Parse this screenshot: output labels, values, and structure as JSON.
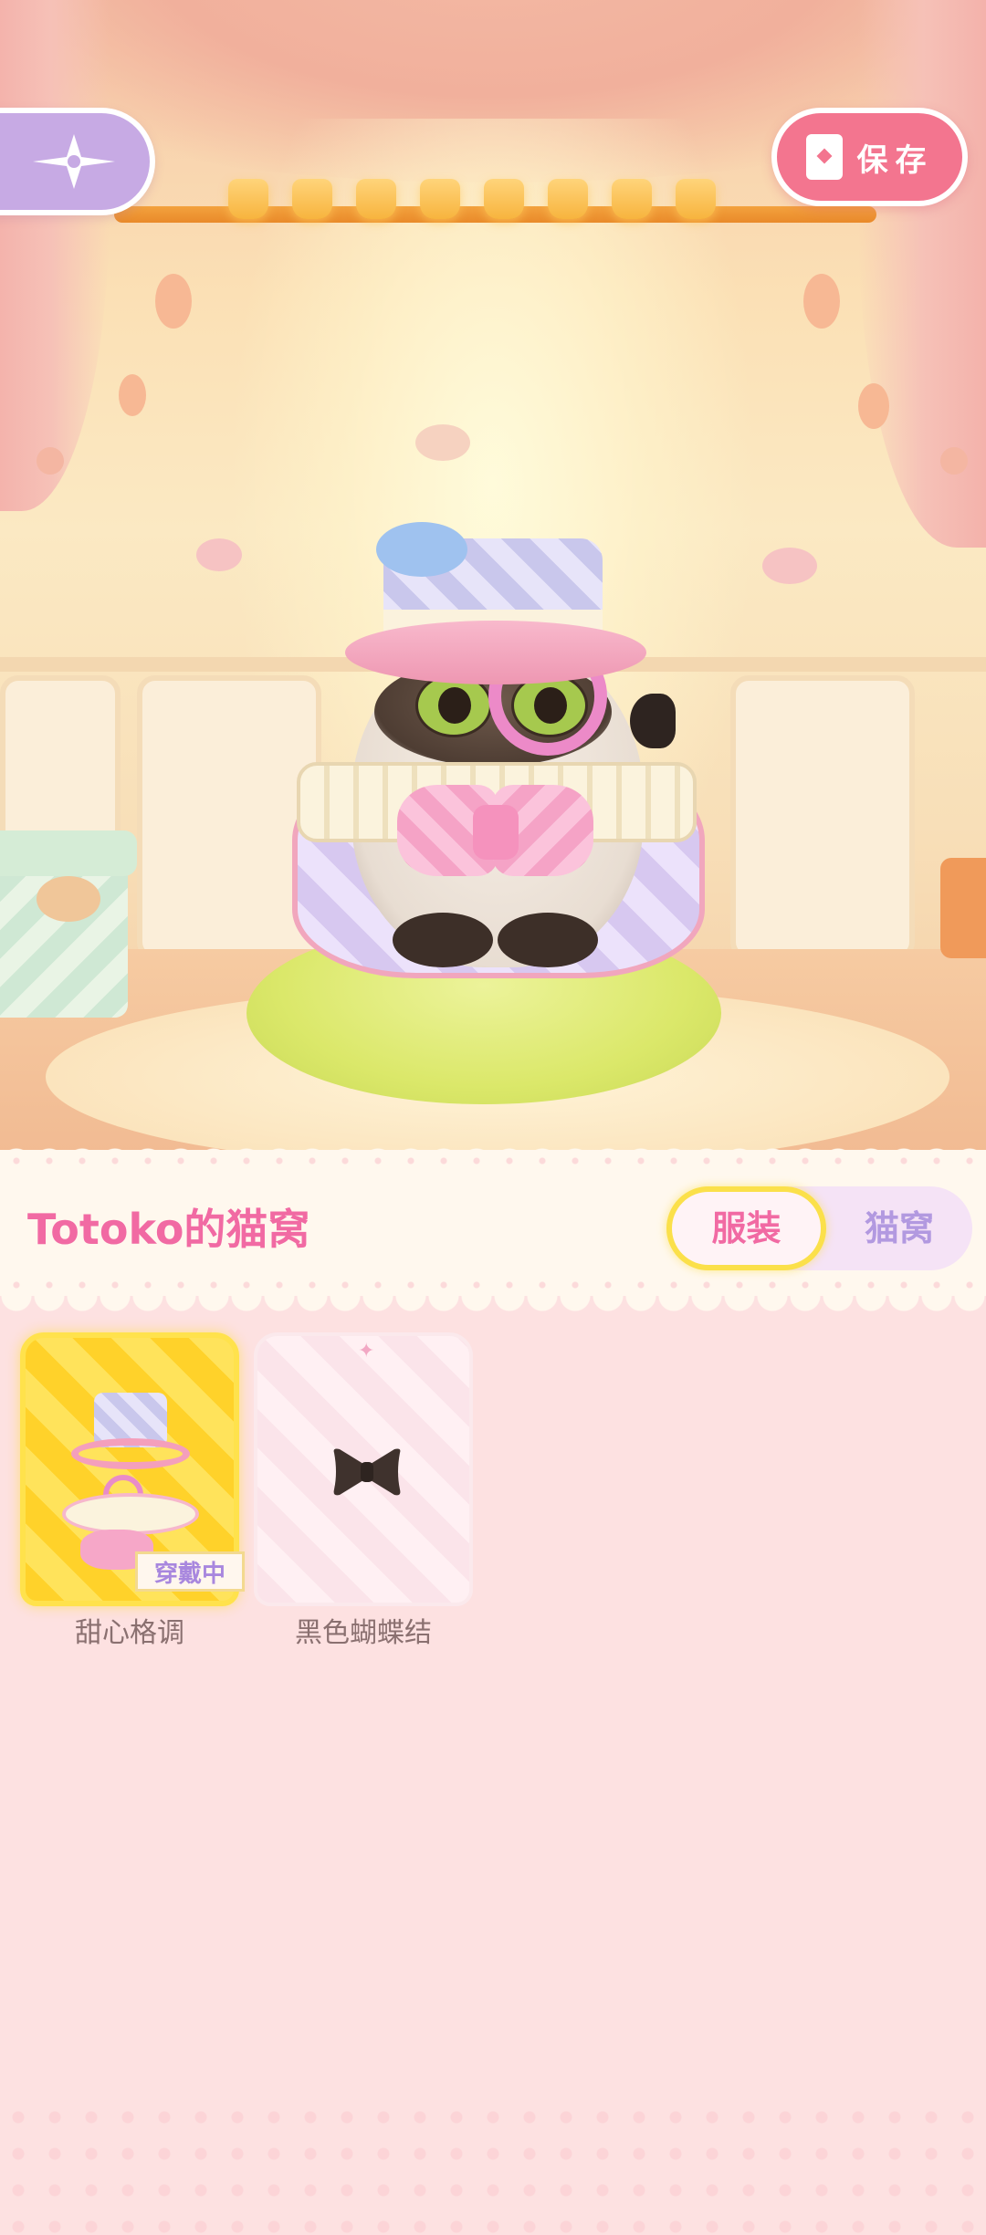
{
  "header": {
    "save_label": "保存",
    "title": "Totoko的猫窝"
  },
  "tabs": [
    {
      "label": "服装",
      "selected": true
    },
    {
      "label": "猫窝",
      "selected": false
    }
  ],
  "items": [
    {
      "name": "甜心格调",
      "badge": "穿戴中",
      "equipped": true
    },
    {
      "name": "黑色蝴蝶结",
      "equipped": false
    }
  ],
  "icons": {
    "back": "compass-star-icon",
    "save": "document-icon"
  },
  "colors": {
    "accent_pink": "#f3758f",
    "title_pink": "#f16aa3",
    "tab_selected_border": "#fbe04a",
    "lavender": "#c7aae4"
  }
}
